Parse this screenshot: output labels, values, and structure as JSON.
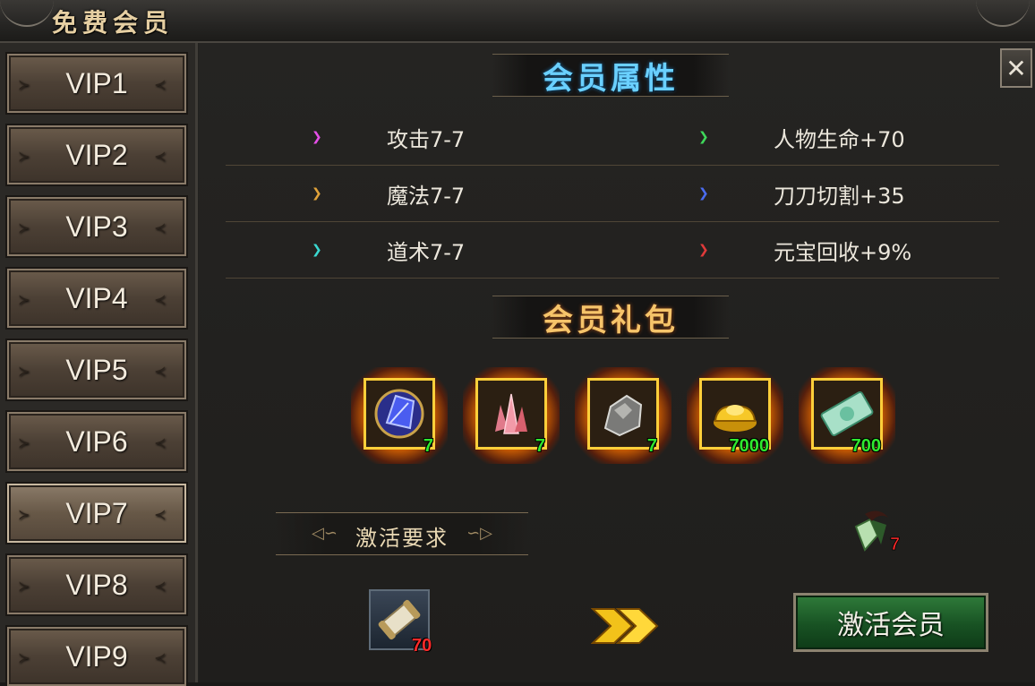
{
  "window": {
    "title": "免费会员",
    "close_label": "✕"
  },
  "sidebar": {
    "items": [
      {
        "label": "VIP1"
      },
      {
        "label": "VIP2"
      },
      {
        "label": "VIP3"
      },
      {
        "label": "VIP4"
      },
      {
        "label": "VIP5"
      },
      {
        "label": "VIP6"
      },
      {
        "label": "VIP7"
      },
      {
        "label": "VIP8"
      },
      {
        "label": "VIP9"
      }
    ],
    "selected": "VIP7"
  },
  "attributes": {
    "title": "会员属性",
    "rows": [
      {
        "left": {
          "text": "攻击7-7",
          "color": "#e54fe8"
        },
        "right": {
          "text": "人物生命+70",
          "color": "#3fd85a"
        }
      },
      {
        "left": {
          "text": "魔法7-7",
          "color": "#e0a23a"
        },
        "right": {
          "text": "刀刀切割+35",
          "color": "#4a6cf0"
        }
      },
      {
        "left": {
          "text": "道术7-7",
          "color": "#3ad8d0"
        },
        "right": {
          "text": "元宝回收+9%",
          "color": "#e03a3a"
        }
      }
    ]
  },
  "gifts": {
    "title": "会员礼包",
    "items": [
      {
        "icon": "blue-crystal-icon",
        "count": "7"
      },
      {
        "icon": "pink-crystal-icon",
        "count": "7"
      },
      {
        "icon": "ore-rock-icon",
        "count": "7"
      },
      {
        "icon": "gold-ingot-icon",
        "count": "7000"
      },
      {
        "icon": "banknote-icon",
        "count": "700"
      }
    ]
  },
  "requirement": {
    "title": "激活要求",
    "item_icon": "scroll-icon",
    "item_count": "70"
  },
  "badge": {
    "icon": "vip-badge-icon",
    "level": "7"
  },
  "actions": {
    "activate_label": "激活会员"
  },
  "colors": {
    "count_green": "#2fe82f",
    "count_red": "#ff2a2a",
    "gift_border": "#ffcf3a"
  }
}
